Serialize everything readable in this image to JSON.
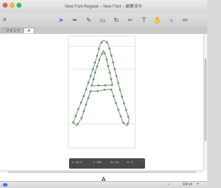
{
  "window": {
    "title": "New Font-Regular – New Font – 編集済み",
    "traffic_light_colors": [
      "#fc605c",
      "#fdbc40",
      "#34c84a"
    ]
  },
  "toolbar": {
    "left_tool_icon": "sidebar-toggle-icon",
    "tools": [
      {
        "name": "select-tool-icon",
        "glyph": "➤",
        "selected": true
      },
      {
        "name": "pen-tool-icon",
        "glyph": "✒",
        "selected": false
      },
      {
        "name": "eraser-tool-icon",
        "glyph": "✎",
        "selected": false
      },
      {
        "name": "rectangle-tool-icon",
        "glyph": "▭",
        "selected": false
      },
      {
        "name": "rotate-tool-icon",
        "glyph": "↻",
        "selected": false
      },
      {
        "name": "cut-tool-icon",
        "glyph": "✂",
        "selected": false
      },
      {
        "name": "text-tool-icon",
        "glyph": "T",
        "selected": false
      },
      {
        "name": "hand-tool-icon",
        "glyph": "✋",
        "selected": false
      },
      {
        "name": "zoom-tool-icon",
        "glyph": "⌕",
        "selected": false
      },
      {
        "name": "pencil-tool-icon",
        "glyph": "✏",
        "selected": false
      }
    ]
  },
  "tabs": [
    {
      "label": "フォント",
      "active": false
    },
    {
      "label": "A",
      "active": true
    }
  ],
  "hud": {
    "x_label": "X",
    "x_value": "16.71",
    "y_label": "Y",
    "y_value": "359",
    "w_label": "W",
    "w_value": "2.6",
    "h_label": "H",
    "h_value": "0"
  },
  "preview": {
    "char": "A"
  },
  "status": {
    "zoom_out": "−",
    "zoom_label": "100 pt",
    "zoom_in": "+"
  },
  "colors": {
    "accent": "#2f7ed8",
    "outline": "#6b8e6b",
    "node": "#7aa27a",
    "metric_line": "#c0c0c0"
  }
}
